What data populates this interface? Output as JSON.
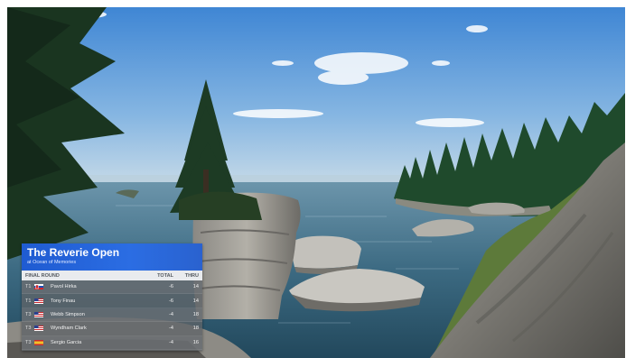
{
  "leaderboard": {
    "title": "The Reverie Open",
    "subtitle": "at Ocean of Memories",
    "columns": {
      "round": "FINAL ROUND",
      "total": "TOTAL",
      "thru": "THRU"
    },
    "rows": [
      {
        "pos": "T1",
        "flag": "slovakia-flag-icon",
        "name": "Pavol Hirka",
        "total": "-6",
        "thru": "14"
      },
      {
        "pos": "T1",
        "flag": "usa-flag-icon",
        "name": "Tony Finau",
        "total": "-6",
        "thru": "14"
      },
      {
        "pos": "T3",
        "flag": "usa-flag-icon",
        "name": "Webb Simpson",
        "total": "-4",
        "thru": "18"
      },
      {
        "pos": "T3",
        "flag": "usa-flag-icon",
        "name": "Wyndham Clark",
        "total": "-4",
        "thru": "18"
      },
      {
        "pos": "T3",
        "flag": "spain-flag-icon",
        "name": "Sergio Garcia",
        "total": "-4",
        "thru": "16"
      }
    ]
  },
  "colors": {
    "header_blue": "#2563d6",
    "sky": "#6fa7dd",
    "water": "#3d6f88"
  }
}
